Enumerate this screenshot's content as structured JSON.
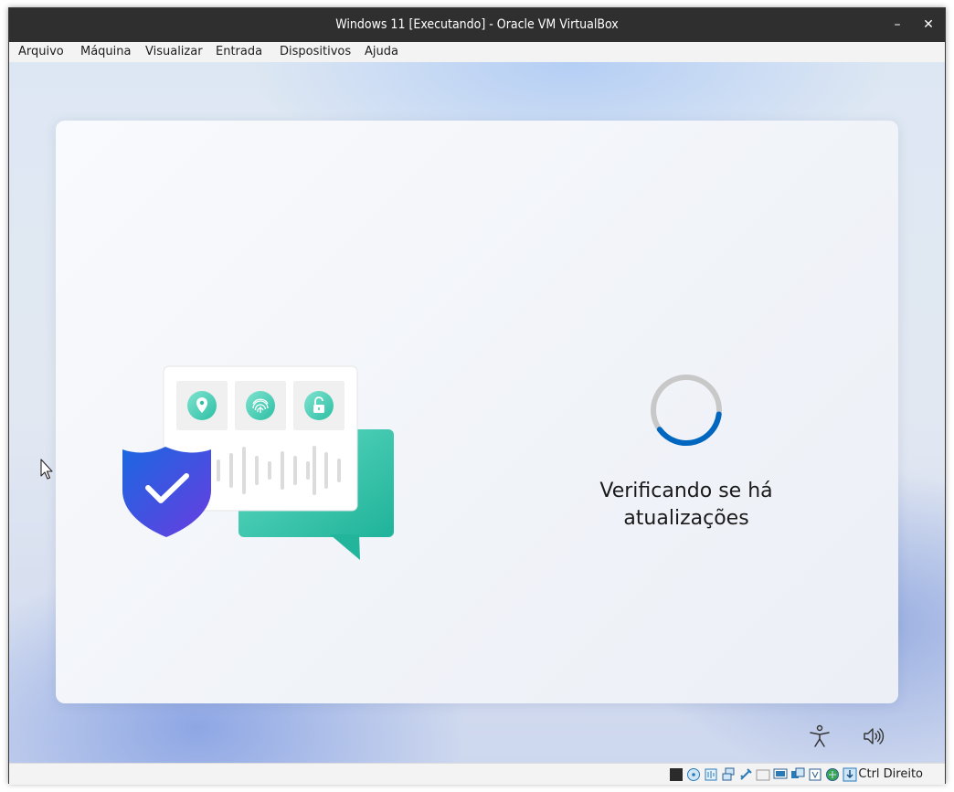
{
  "window": {
    "title": "Windows 11 [Executando] - Oracle VM VirtualBox",
    "minimize_glyph": "–",
    "close_glyph": "✕"
  },
  "menu": {
    "items": [
      "Arquivo",
      "Máquina",
      "Visualizar",
      "Entrada",
      "Dispositivos",
      "Ajuda"
    ]
  },
  "oobe": {
    "status_line1": "Verificando se há",
    "status_line2": "atualizações",
    "spinner_progress": 0.38,
    "accent_color": "#0067c0"
  },
  "bottom_icons": [
    "accessibility-icon",
    "volume-icon"
  ],
  "statusbar": {
    "icons": [
      "hard-disk-icon",
      "optical-drive-icon",
      "audio-icon",
      "network-icon",
      "usb-icon",
      "shared-folder-icon",
      "display-icon",
      "video-capture-icon",
      "cpu-icon",
      "guest-additions-icon",
      "keyboard-capture-icon",
      "mouse-integration-icon"
    ],
    "host_key": "Ctrl Direito"
  }
}
